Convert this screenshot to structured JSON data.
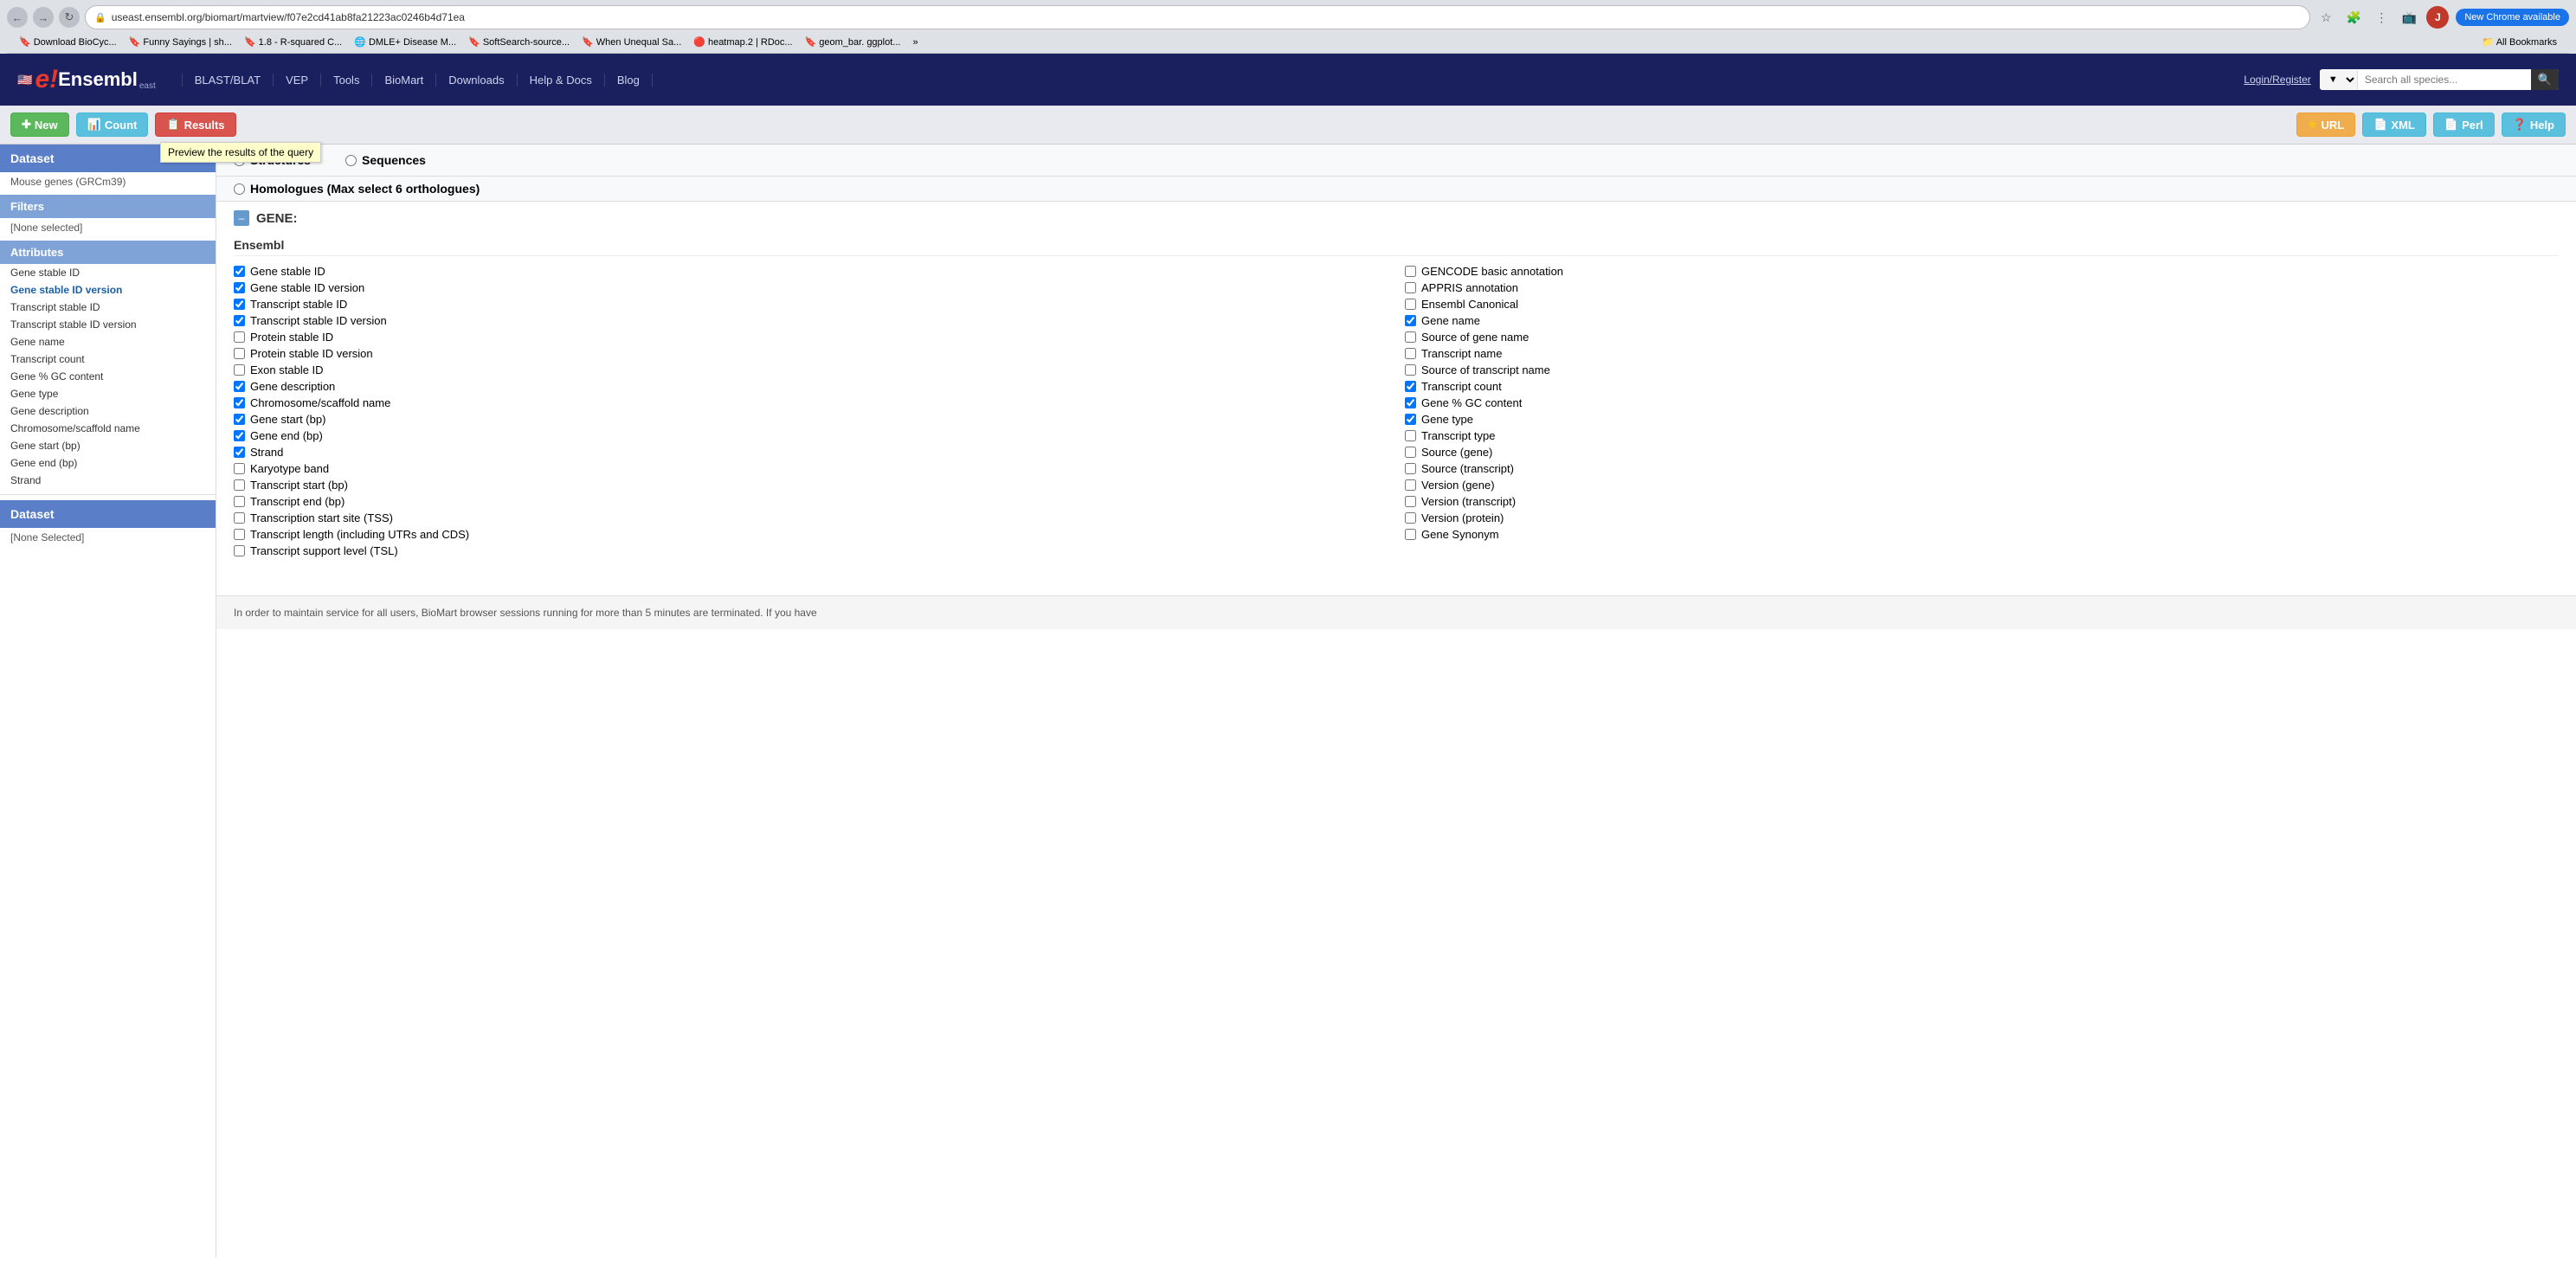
{
  "browser": {
    "url": "useast.ensembl.org/biomart/martview/f07e2cd41ab8fa21223ac0246b4d71ea",
    "back_btn": "←",
    "forward_btn": "→",
    "reload_btn": "↻",
    "new_chrome_label": "New Chrome available",
    "bookmarks": [
      {
        "label": "Download BioCyc...",
        "icon": "🔖"
      },
      {
        "label": "Funny Sayings | sh...",
        "icon": "🔖"
      },
      {
        "label": "1.8 - R-squared C...",
        "icon": "🔖"
      },
      {
        "label": "DMLE+ Disease M...",
        "icon": "🌐"
      },
      {
        "label": "SoftSearch-source...",
        "icon": "🔖"
      },
      {
        "label": "When Unequal Sa...",
        "icon": "🔖"
      },
      {
        "label": "heatmap.2 | RDoc...",
        "icon": "🔴"
      },
      {
        "label": "geom_bar. ggplot...",
        "icon": "🔖"
      }
    ],
    "bookmarks_more": "»",
    "all_bookmarks": "All Bookmarks"
  },
  "ensembl_header": {
    "logo_text": "e!Ensembl",
    "nav_items": [
      {
        "label": "BLAST/BLAT"
      },
      {
        "label": "VEP"
      },
      {
        "label": "Tools"
      },
      {
        "label": "BioMart"
      },
      {
        "label": "Downloads"
      },
      {
        "label": "Help & Docs"
      },
      {
        "label": "Blog"
      }
    ],
    "login_label": "Login/Register",
    "search_placeholder": "Search all species..."
  },
  "biomart_toolbar": {
    "new_label": "New",
    "count_label": "Count",
    "results_label": "Results",
    "url_label": "URL",
    "xml_label": "XML",
    "perl_label": "Perl",
    "help_label": "Help",
    "tooltip_text": "Preview the results of the query"
  },
  "sidebar": {
    "dataset_label": "Dataset",
    "dataset_value": "Mouse genes (GRCm39)",
    "filters_label": "Filters",
    "filters_value": "[None selected]",
    "attributes_label": "Attributes",
    "sidebar_items": [
      {
        "label": "Gene stable ID",
        "active": false
      },
      {
        "label": "Gene stable ID version",
        "active": true
      },
      {
        "label": "Transcript stable ID",
        "active": false
      },
      {
        "label": "Transcript stable ID version",
        "active": false
      },
      {
        "label": "Gene name",
        "active": false
      },
      {
        "label": "Transcript count",
        "active": false
      },
      {
        "label": "Gene % GC content",
        "active": false
      },
      {
        "label": "Gene type",
        "active": false
      },
      {
        "label": "Gene description",
        "active": false
      },
      {
        "label": "Chromosome/scaffold name",
        "active": false
      },
      {
        "label": "Gene start (bp)",
        "active": false
      },
      {
        "label": "Gene end (bp)",
        "active": false
      },
      {
        "label": "Strand",
        "active": false
      }
    ],
    "dataset2_label": "Dataset",
    "dataset2_value": "[None Selected]"
  },
  "content": {
    "radio_options": [
      {
        "label": "Structures",
        "checked": false
      },
      {
        "label": "Sequences",
        "checked": false
      },
      {
        "label": "Homologues (Max select 6 orthologues)",
        "checked": false
      }
    ],
    "gene_section_title": "GENE:",
    "ensembl_section_title": "Ensembl",
    "checkboxes_left": [
      {
        "label": "Gene stable ID",
        "checked": true
      },
      {
        "label": "Gene stable ID version",
        "checked": true
      },
      {
        "label": "Transcript stable ID",
        "checked": true
      },
      {
        "label": "Transcript stable ID version",
        "checked": true
      },
      {
        "label": "Protein stable ID",
        "checked": false
      },
      {
        "label": "Protein stable ID version",
        "checked": false
      },
      {
        "label": "Exon stable ID",
        "checked": false
      },
      {
        "label": "Gene description",
        "checked": true
      },
      {
        "label": "Chromosome/scaffold name",
        "checked": true
      },
      {
        "label": "Gene start (bp)",
        "checked": true
      },
      {
        "label": "Gene end (bp)",
        "checked": true
      },
      {
        "label": "Strand",
        "checked": true
      },
      {
        "label": "Karyotype band",
        "checked": false
      },
      {
        "label": "Transcript start (bp)",
        "checked": false
      },
      {
        "label": "Transcript end (bp)",
        "checked": false
      },
      {
        "label": "Transcription start site (TSS)",
        "checked": false
      },
      {
        "label": "Transcript length (including UTRs and CDS)",
        "checked": false
      },
      {
        "label": "Transcript support level (TSL)",
        "checked": false
      }
    ],
    "checkboxes_right": [
      {
        "label": "GENCODE basic annotation",
        "checked": false
      },
      {
        "label": "APPRIS annotation",
        "checked": false
      },
      {
        "label": "Ensembl Canonical",
        "checked": false
      },
      {
        "label": "Gene name",
        "checked": true
      },
      {
        "label": "Source of gene name",
        "checked": false
      },
      {
        "label": "Transcript name",
        "checked": false
      },
      {
        "label": "Source of transcript name",
        "checked": false
      },
      {
        "label": "Transcript count",
        "checked": true
      },
      {
        "label": "Gene % GC content",
        "checked": true
      },
      {
        "label": "Gene type",
        "checked": true
      },
      {
        "label": "Transcript type",
        "checked": false
      },
      {
        "label": "Source (gene)",
        "checked": false
      },
      {
        "label": "Source (transcript)",
        "checked": false
      },
      {
        "label": "Version (gene)",
        "checked": false
      },
      {
        "label": "Version (transcript)",
        "checked": false
      },
      {
        "label": "Version (protein)",
        "checked": false
      },
      {
        "label": "Gene Synonym",
        "checked": false
      }
    ],
    "bottom_notice": "In order to maintain service for all users, BioMart browser sessions running for more than 5 minutes are terminated. If you have"
  }
}
